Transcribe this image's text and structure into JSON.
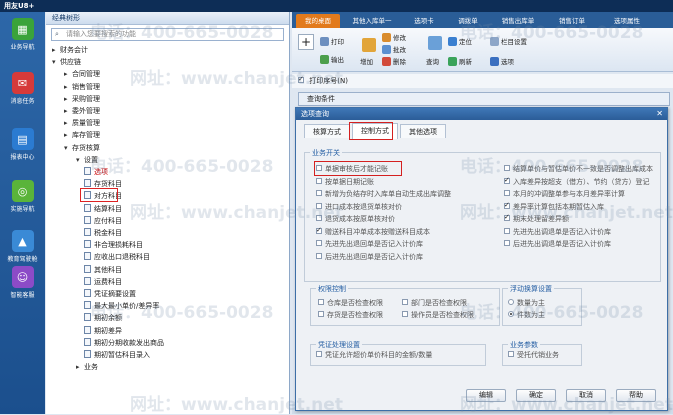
{
  "app": {
    "title": "用友U8+"
  },
  "leftbar": {
    "items": [
      {
        "label": "业务导航",
        "icon": "grid-icon",
        "color": "#3aa33a"
      },
      {
        "label": "消息任务",
        "icon": "message-icon",
        "color": "#d63a3a"
      },
      {
        "label": "报表中心",
        "icon": "report-icon",
        "color": "#2b7bd1"
      },
      {
        "label": "实施导航",
        "icon": "compass-icon",
        "color": "#5ab43a"
      },
      {
        "label": "教育驾驶舱",
        "icon": "graduation-icon",
        "color": "#3a8ad6"
      },
      {
        "label": "智能客服",
        "icon": "service-icon",
        "color": "#8c4bc7"
      }
    ]
  },
  "nav": {
    "header": "经典树形",
    "search_placeholder": "请输入您要搜索的功能",
    "tree": [
      {
        "label": "财务会计",
        "toggle": "▸",
        "level": 0
      },
      {
        "label": "供应链",
        "toggle": "▾",
        "level": 0
      },
      {
        "label": "合同管理",
        "toggle": "▸",
        "level": 1
      },
      {
        "label": "销售管理",
        "toggle": "▸",
        "level": 1
      },
      {
        "label": "采购管理",
        "toggle": "▸",
        "level": 1
      },
      {
        "label": "委外管理",
        "toggle": "▸",
        "level": 1
      },
      {
        "label": "质量管理",
        "toggle": "▸",
        "level": 1
      },
      {
        "label": "库存管理",
        "toggle": "▸",
        "level": 1
      },
      {
        "label": "存货核算",
        "toggle": "▾",
        "level": 1
      },
      {
        "label": "设置",
        "toggle": "▾",
        "level": 2
      },
      {
        "label": "选项",
        "toggle": "",
        "level": 3,
        "doc": true,
        "selected": true
      },
      {
        "label": "存货科目",
        "toggle": "",
        "level": 3,
        "doc": true
      },
      {
        "label": "对方科目",
        "toggle": "",
        "level": 3,
        "doc": true
      },
      {
        "label": "结算科目",
        "toggle": "",
        "level": 3,
        "doc": true
      },
      {
        "label": "应付科目",
        "toggle": "",
        "level": 3,
        "doc": true
      },
      {
        "label": "税金科目",
        "toggle": "",
        "level": 3,
        "doc": true
      },
      {
        "label": "非合理损耗科目",
        "toggle": "",
        "level": 3,
        "doc": true
      },
      {
        "label": "应收出口退税科目",
        "toggle": "",
        "level": 3,
        "doc": true
      },
      {
        "label": "其他科目",
        "toggle": "",
        "level": 3,
        "doc": true
      },
      {
        "label": "运费科目",
        "toggle": "",
        "level": 3,
        "doc": true
      },
      {
        "label": "凭证摘要设置",
        "toggle": "",
        "level": 3,
        "doc": true
      },
      {
        "label": "最大最小单价/差异率",
        "toggle": "",
        "level": 3,
        "doc": true
      },
      {
        "label": "期初余额",
        "toggle": "",
        "level": 3,
        "doc": true
      },
      {
        "label": "期初差异",
        "toggle": "",
        "level": 3,
        "doc": true
      },
      {
        "label": "期初分期收款发出商品",
        "toggle": "",
        "level": 3,
        "doc": true
      },
      {
        "label": "期初暂估科目录入",
        "toggle": "",
        "level": 3,
        "doc": true
      },
      {
        "label": "业务",
        "toggle": "▸",
        "level": 2
      }
    ]
  },
  "tabs": [
    "我的桌面",
    "其他入库单一",
    "选项卡",
    "调拨单",
    "销售出库单",
    "销售订单",
    "选项属性"
  ],
  "toolbar": {
    "print": "打印",
    "output": "输出",
    "add": "增加",
    "modify": "修改",
    "copy": "批改",
    "delete": "删除",
    "query": "查询",
    "locate": "定位",
    "refresh": "刷新",
    "columns": "栏目设置",
    "options": "选项"
  },
  "print_row": {
    "label": "打印序号(N)"
  },
  "grid": {
    "header": "查询条件"
  },
  "dialog": {
    "title": "选项查询",
    "tabs": [
      "核算方式",
      "控制方式",
      "其他选项"
    ],
    "groups": {
      "business": "业务开关",
      "permission": "权限控制",
      "floating": "浮动换算设置",
      "voucher": "凭证处理设置",
      "business_param": "业务参数"
    },
    "left_options": [
      {
        "label": "单据审核后才能记账",
        "checked": false
      },
      {
        "label": "按单据日期记账",
        "checked": false
      },
      {
        "label": "新增为负结存时入库单自动生成出库调整",
        "checked": false
      },
      {
        "label": "进口成本按退货单核对价",
        "checked": false
      },
      {
        "label": "退货成本按原单核对价",
        "checked": false
      },
      {
        "label": "赠送科目冲单成本按赠送科目成本",
        "checked": true
      },
      {
        "label": "先进先出退回单是否记入计价库",
        "checked": false
      },
      {
        "label": "后进先出退回单是否记入计价库",
        "checked": false
      }
    ],
    "right_options": [
      {
        "label": "结算单价与暂估单价不一致是否调整出库成本",
        "checked": false
      },
      {
        "label": "入库差异按超支（借方）、节约（贷方）登记",
        "checked": true
      },
      {
        "label": "本月的冲调整单参与本月差异率计算",
        "checked": false
      },
      {
        "label": "差异率计算包括本期暂估入库",
        "checked": true
      },
      {
        "label": "期末处理留差异额",
        "checked": true
      },
      {
        "label": "先进先出调退单是否记入计价库",
        "checked": false
      },
      {
        "label": "后进先出调退单是否记入计价库",
        "checked": false
      }
    ],
    "permission_options": [
      {
        "label": "仓库是否检查权限",
        "checked": false
      },
      {
        "label": "部门是否检查权限",
        "checked": false
      },
      {
        "label": "存货是否检查权限",
        "checked": false
      },
      {
        "label": "操作员是否检查权限",
        "checked": false
      }
    ],
    "floating_options": [
      {
        "label": "数量为主",
        "checked": false
      },
      {
        "label": "件数为主",
        "checked": true
      }
    ],
    "voucher_option": {
      "label": "凭证允许超价单价科目的金额/数量",
      "checked": false
    },
    "business_param_option": {
      "label": "受托代销业务",
      "checked": false
    },
    "buttons": {
      "edit": "编辑",
      "ok": "确定",
      "cancel": "取消",
      "help": "帮助"
    }
  },
  "watermark": {
    "phone": "电话：400-665-0028",
    "site": "网址：www.chanjet.net"
  }
}
